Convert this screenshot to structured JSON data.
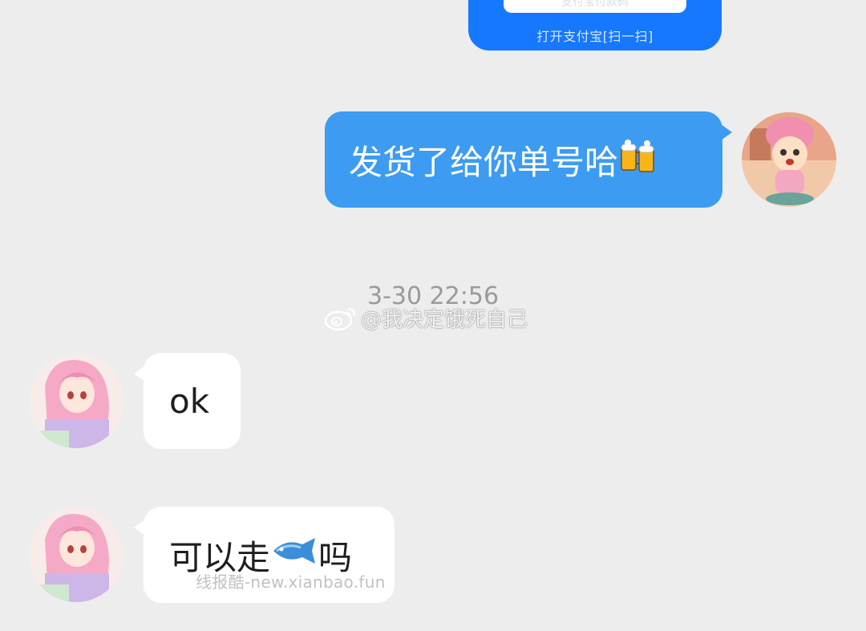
{
  "alipay_card": {
    "inner_text": "支付宝付款码",
    "hint": "打开支付宝[扫一扫]",
    "color": "#1677ff"
  },
  "messages": [
    {
      "side": "right",
      "text": "发货了给你单号哈",
      "emoji": "beer-mugs-icon"
    },
    {
      "side": "left",
      "text": "ok"
    },
    {
      "side": "left",
      "text": "可以走",
      "emoji": "fish-icon",
      "text_after": "吗"
    }
  ],
  "timestamp": "3-30 22:56",
  "watermarks": {
    "weibo": "@我决定饿死自己",
    "site": "线报酷-new.xianbao.fun"
  },
  "colors": {
    "background": "#ededed",
    "outgoing_bubble": "#3d9bf2",
    "incoming_bubble": "#ffffff"
  }
}
